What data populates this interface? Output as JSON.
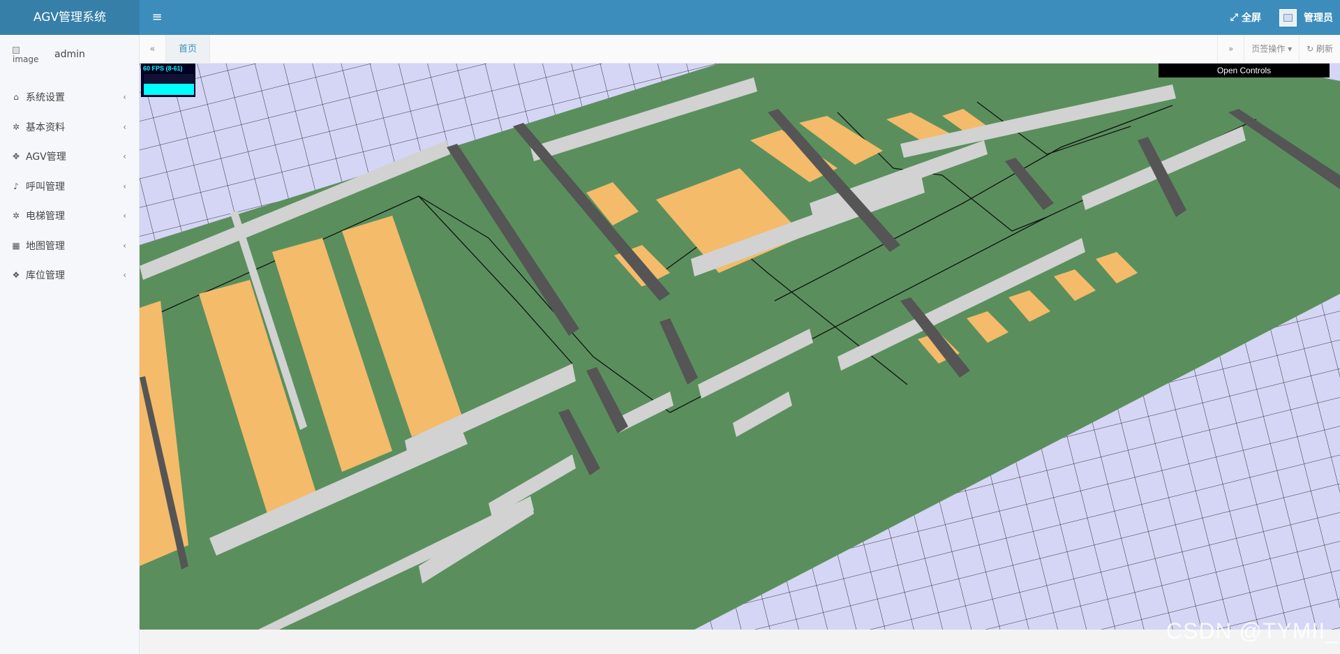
{
  "header": {
    "brand": "AGV管理系统",
    "menu_toggle_icon": "hamburger-icon",
    "fullscreen_label": "全屏",
    "user_label": "管理员"
  },
  "sidebar": {
    "avatar_alt": "image",
    "username": "admin",
    "items": [
      {
        "label": "系统设置",
        "icon": "home-icon"
      },
      {
        "label": "基本资料",
        "icon": "gear-icon"
      },
      {
        "label": "AGV管理",
        "icon": "move-icon"
      },
      {
        "label": "呼叫管理",
        "icon": "bell-icon"
      },
      {
        "label": "电梯管理",
        "icon": "gear-icon"
      },
      {
        "label": "地图管理",
        "icon": "map-icon"
      },
      {
        "label": "库位管理",
        "icon": "cubes-icon"
      }
    ]
  },
  "tabs": {
    "home_label": "首页",
    "ops_label": "页签操作",
    "refresh_label": "刷新"
  },
  "scene": {
    "fps_text": "60 FPS (8-61)",
    "fps_level": 0.55,
    "controls_label": "Open Controls",
    "colors": {
      "floor": "#5a8f5d",
      "grid_bg": "#d5d5f5",
      "grid_line": "#000000",
      "shelf": "#f4bb6a",
      "wall_light": "#d2d2d2",
      "wall_dark": "#555555"
    }
  },
  "watermark": "CSDN @TYMII_"
}
